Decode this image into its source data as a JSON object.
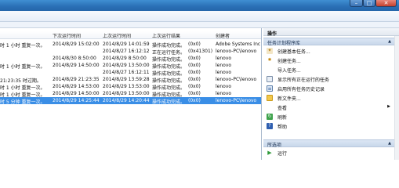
{
  "window": {
    "minimize_glyph": "–",
    "maximize_glyph": "□",
    "close_glyph": "✕"
  },
  "table": {
    "columns": [
      "",
      "下次运行时间",
      "上次运行时间",
      "上次运行结果",
      "",
      "创建者"
    ],
    "rows": [
      [
        "时 1 小时 重复一次。",
        "2014/8/29 15:02:00",
        "2014/8/29 14:01:59",
        "操作成功完成。",
        "(0x0)",
        "Adobe Systems Inc"
      ],
      [
        "",
        "",
        "2014/8/27 16:12:12",
        "正在运行任务。",
        "(0x41301)",
        "lenovo-PC\\lenovo"
      ],
      [
        "",
        "2014/8/30 8:50:00",
        "2014/8/29 8:50:00",
        "操作成功完成。",
        "(0x0)",
        "lenovo"
      ],
      [
        "时 1 小时 重复一次。",
        "2014/8/29 14:50:00",
        "2014/8/29 13:50:00",
        "操作成功完成。",
        "(0x0)",
        "lenovo"
      ],
      [
        "",
        "",
        "2014/8/27 16:12:11",
        "操作成功完成。",
        "(0x0)",
        "lenovo"
      ],
      [
        "21:23:35 时过期。",
        "2014/8/29 21:23:35",
        "2014/8/29 13:59:28",
        "操作成功完成。",
        "(0x0)",
        "lenovo-PC\\lenovo"
      ],
      [
        "时 1 小时 重复一次。",
        "2014/8/29 14:53:00",
        "2014/8/29 13:53:00",
        "操作成功完成。",
        "(0x0)",
        "lenovo"
      ],
      [
        "时 1 小时 重复一次。",
        "2014/8/29 14:50:00",
        "2014/8/29 13:50:00",
        "操作成功完成。",
        "(0x0)",
        "lenovo"
      ],
      [
        "时 5 分钟 重复一次。",
        "2014/8/29 14:25:44",
        "2014/8/29 14:20:44",
        "操作成功完成。",
        "(0x0)",
        "lenovo-PC\\lenovo"
      ]
    ],
    "selected_row": 8
  },
  "actions": {
    "title": "操作",
    "section1": "任务计划程序库",
    "items": [
      {
        "label": "创建基本任务...",
        "icon": "create-basic-task-icon"
      },
      {
        "label": "创建任务...",
        "icon": "create-task-icon"
      },
      {
        "label": "导入任务...",
        "icon": "import-task-icon"
      },
      {
        "label": "显示所有正在运行的任务",
        "icon": "running-tasks-icon"
      },
      {
        "label": "启用所有任务历史记录",
        "icon": "history-icon"
      },
      {
        "label": "新文件夹...",
        "icon": "new-folder-icon"
      },
      {
        "label": "查看",
        "icon": "view-icon",
        "submenu": true
      },
      {
        "label": "刷新",
        "icon": "refresh-icon"
      },
      {
        "label": "帮助",
        "icon": "help-icon"
      }
    ],
    "section2": "所选项",
    "section2_items": [
      {
        "label": "运行",
        "icon": "run-icon"
      }
    ],
    "colors": {
      "selection": "#3a8ee6",
      "section_bg": "#c8d7ea"
    }
  }
}
